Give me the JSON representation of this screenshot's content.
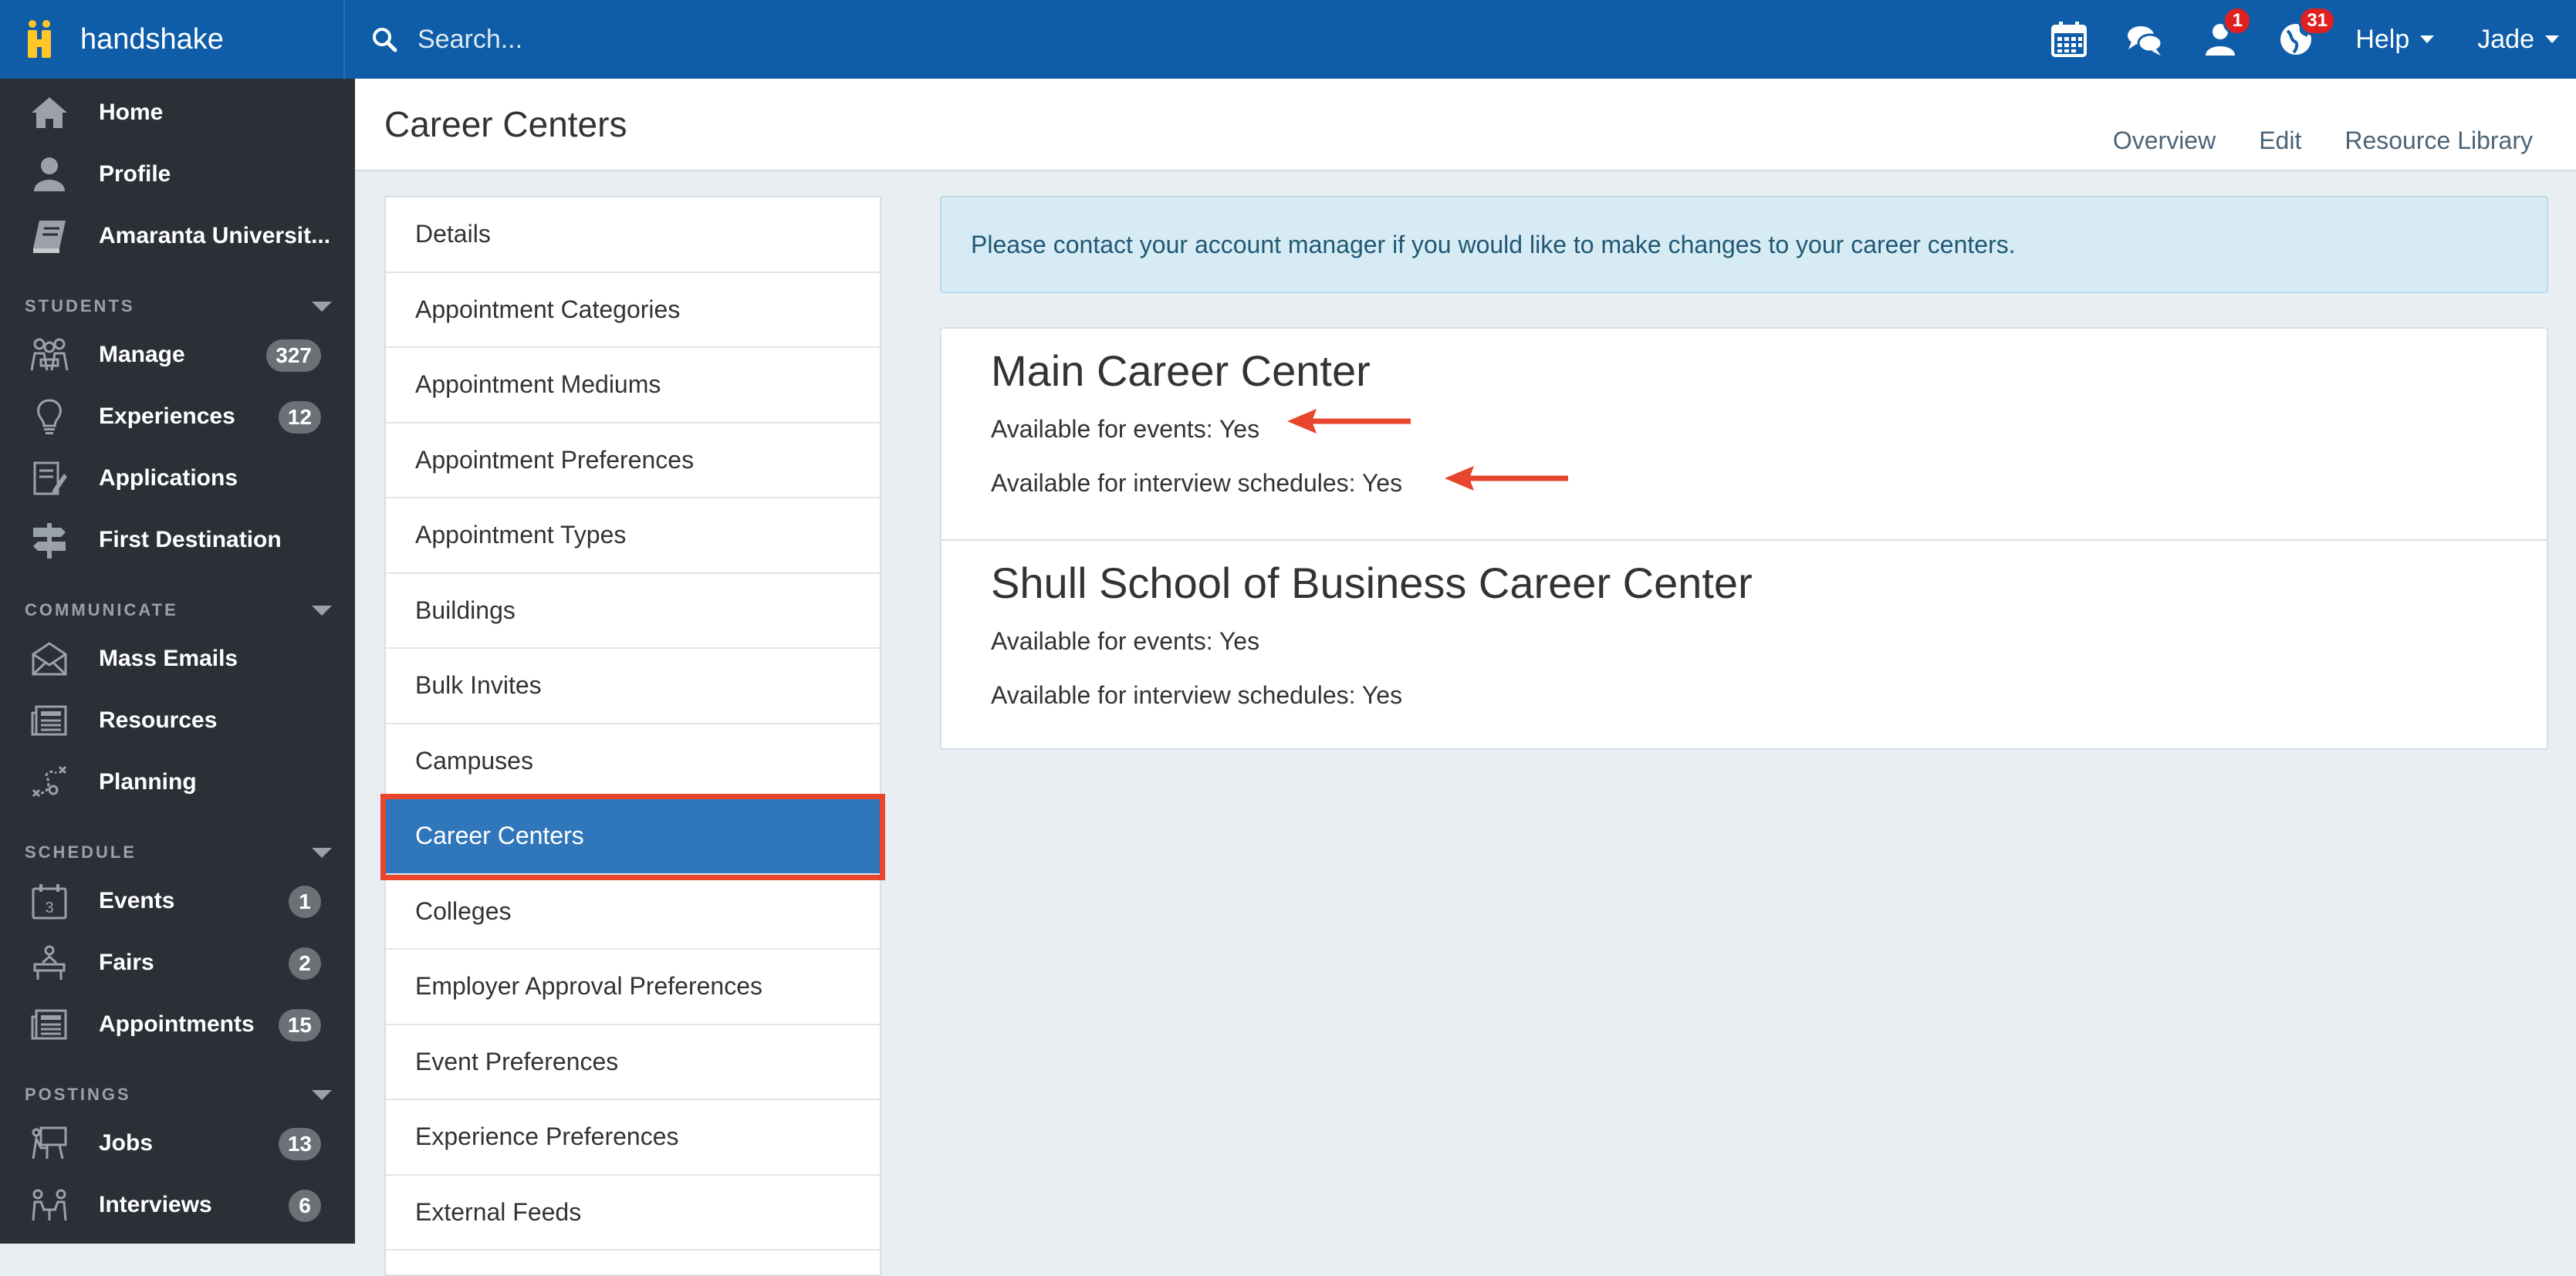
{
  "brand": {
    "name": "handshake"
  },
  "search": {
    "placeholder": "Search..."
  },
  "topbar": {
    "badges": {
      "people": "1",
      "globe": "31"
    },
    "help_label": "Help",
    "user_label": "Jade"
  },
  "sidebar": {
    "top_items": [
      {
        "label": "Home",
        "icon": "home-icon"
      },
      {
        "label": "Profile",
        "icon": "person-icon"
      },
      {
        "label": "Amaranta Universit...",
        "icon": "book-icon"
      }
    ],
    "sections": [
      {
        "label": "STUDENTS",
        "items": [
          {
            "label": "Manage",
            "count": "327",
            "icon": "students-icon"
          },
          {
            "label": "Experiences",
            "count": "12",
            "icon": "lightbulb-icon"
          },
          {
            "label": "Applications",
            "count": "",
            "icon": "document-icon"
          },
          {
            "label": "First Destination",
            "count": "",
            "icon": "signpost-icon"
          }
        ]
      },
      {
        "label": "COMMUNICATE",
        "items": [
          {
            "label": "Mass Emails",
            "count": "",
            "icon": "envelope-icon"
          },
          {
            "label": "Resources",
            "count": "",
            "icon": "newspaper-icon"
          },
          {
            "label": "Planning",
            "count": "",
            "icon": "strategy-icon"
          }
        ]
      },
      {
        "label": "SCHEDULE",
        "items": [
          {
            "label": "Events",
            "count": "1",
            "icon": "calendar-icon"
          },
          {
            "label": "Fairs",
            "count": "2",
            "icon": "booth-icon"
          },
          {
            "label": "Appointments",
            "count": "15",
            "icon": "newspaper-icon"
          }
        ]
      },
      {
        "label": "POSTINGS",
        "items": [
          {
            "label": "Jobs",
            "count": "13",
            "icon": "easel-icon"
          },
          {
            "label": "Interviews",
            "count": "6",
            "icon": "interview-icon"
          }
        ]
      }
    ]
  },
  "header": {
    "title": "Career Centers",
    "tabs": [
      "Overview",
      "Edit",
      "Resource Library"
    ]
  },
  "settings_menu": {
    "items": [
      "Details",
      "Appointment Categories",
      "Appointment Mediums",
      "Appointment Preferences",
      "Appointment Types",
      "Buildings",
      "Bulk Invites",
      "Campuses",
      "Career Centers",
      "Colleges",
      "Employer Approval Preferences",
      "Event Preferences",
      "Experience Preferences",
      "External Feeds"
    ],
    "active": "Career Centers"
  },
  "alert": {
    "text": "Please contact your account manager if you would like to make changes to your career centers."
  },
  "career_centers": [
    {
      "name": "Main Career Center",
      "events": "Available for events: Yes",
      "interviews": "Available for interview schedules: Yes"
    },
    {
      "name": "Shull School of Business Career Center",
      "events": "Available for events: Yes",
      "interviews": "Available for interview schedules: Yes"
    }
  ],
  "colors": {
    "topbar": "#0f5da8",
    "sidebar": "#2b3036",
    "active": "#2f76ba",
    "highlight": "#e8452c",
    "arrow": "#e8452c"
  }
}
